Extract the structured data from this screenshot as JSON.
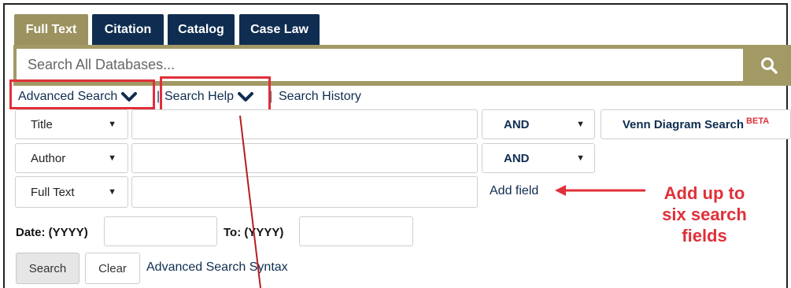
{
  "tabs": [
    {
      "label": "Full Text",
      "active": true
    },
    {
      "label": "Citation",
      "active": false
    },
    {
      "label": "Catalog",
      "active": false
    },
    {
      "label": "Case Law",
      "active": false
    }
  ],
  "search": {
    "placeholder": "Search All Databases...",
    "button_icon": "search-icon"
  },
  "links": {
    "advanced_search": "Advanced Search",
    "search_help": "Search Help",
    "search_history": "Search History",
    "separator": "|"
  },
  "fields": [
    {
      "type": "Title",
      "value": "",
      "operator": "AND"
    },
    {
      "type": "Author",
      "value": "",
      "operator": "AND"
    },
    {
      "type": "Full Text",
      "value": ""
    }
  ],
  "venn": {
    "label": "Venn Diagram Search",
    "badge": "BETA"
  },
  "add_field": "Add field",
  "annotation": {
    "line1": "Add up to",
    "line2": "six search",
    "line3": "fields"
  },
  "date": {
    "from_label": "Date: (YYYY)",
    "to_label": "To: (YYYY)",
    "from_value": "",
    "to_value": ""
  },
  "buttons": {
    "search": "Search",
    "clear": "Clear",
    "syntax": "Advanced Search Syntax"
  },
  "colors": {
    "gold": "#a39965",
    "navy": "#0f2d50",
    "highlight_red": "#e0303a"
  }
}
